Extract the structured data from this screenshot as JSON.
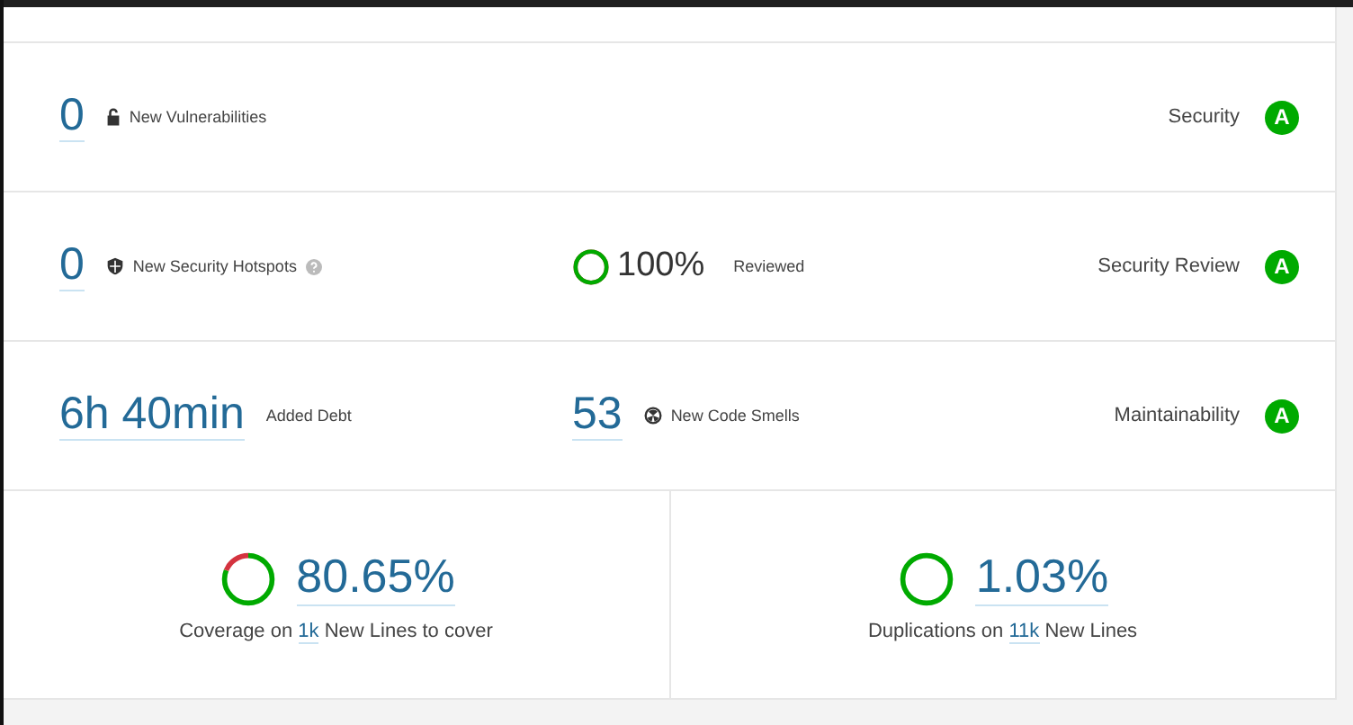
{
  "rows": [
    {
      "primary": {
        "value": "0",
        "label": "New Vulnerabilities"
      },
      "rating": {
        "label": "Security",
        "grade": "A"
      }
    },
    {
      "primary": {
        "value": "0",
        "label": "New Security Hotspots"
      },
      "secondary": {
        "kind": "ring",
        "value": "100%",
        "label": "Reviewed"
      },
      "rating": {
        "label": "Security Review",
        "grade": "A"
      }
    },
    {
      "primary": {
        "value": "6h 40min",
        "label": "Added Debt"
      },
      "secondary": {
        "kind": "icon",
        "value": "53",
        "label": "New Code Smells"
      },
      "rating": {
        "label": "Maintainability",
        "grade": "A"
      }
    }
  ],
  "bottom": [
    {
      "value": "80.65%",
      "prefix": "Coverage on",
      "link": "1k",
      "suffix": "New Lines to cover"
    },
    {
      "value": "1.03%",
      "prefix": "Duplications on",
      "link": "11k",
      "suffix": "New Lines"
    }
  ]
}
